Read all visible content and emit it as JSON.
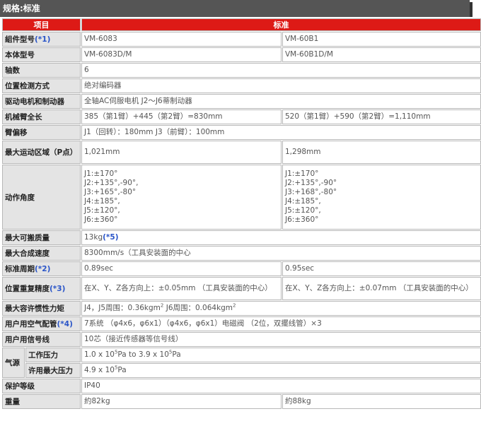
{
  "header": {
    "title": "规格:标准"
  },
  "table": {
    "col_item": "项目",
    "col_std": "标准",
    "rows": {
      "model": {
        "label": "組件型号",
        "ref": "(*1)",
        "a": "VM-6083",
        "b": "VM-60B1"
      },
      "body_model": {
        "label": "本体型号",
        "a": "VM-6083D/M",
        "b": "VM-60B1D/M"
      },
      "axes": {
        "label": "轴数",
        "v": "6"
      },
      "position": {
        "label": "位置检测方式",
        "v": "绝对编码器"
      },
      "drive": {
        "label": "驱动电机和制动器",
        "v": "全轴AC伺服电机 J2～J6蒂制动器"
      },
      "arm_length": {
        "label": "机械臂全长",
        "a": "385（第1臂）+445（第2臂）=830mm",
        "b": "520（第1臂）+590（第2臂）=1,110mm"
      },
      "offset": {
        "label": "臂偏移",
        "v": "J1（回转）：180mm J3（前臂）：100mm"
      },
      "reach": {
        "label": "最大运动区域（P点）",
        "a": "1,021mm",
        "b": "1,298mm"
      },
      "motion": {
        "label": "动作角度",
        "a": [
          "J1:±170°",
          "J2:+135°,-90°,",
          "J3:+165°,-80°",
          "J4:±185°,",
          "J5:±120°,",
          "J6:±360°"
        ],
        "b": [
          "J1:±170°",
          "J2:+135°,-90°",
          "J3:+168°,-80°",
          "J4:±185°,",
          "J5:±120°,",
          "J6:±360°"
        ]
      },
      "payload": {
        "label": "最大可搬质量",
        "v": "13kg",
        "ref": "(*5)"
      },
      "speed": {
        "label": "最大合成速度",
        "v": "8300mm/s（工具安装面的中心"
      },
      "cycle": {
        "label": "标准周期",
        "ref": "(*2)",
        "a": "0.89sec",
        "b": "0.95sec"
      },
      "repeat": {
        "label": "位置重复精度",
        "ref": "(*3)",
        "a": "在X、Y、Z各方向上：±0.05mm （工具安装面的中心）",
        "b": "在X、Y、Z各方向上：±0.07mm （工具安装面的中心）"
      },
      "inertia": {
        "label": "最大容许惯性力矩",
        "v1": "J4，J5周围：0.36kgm",
        "v1_sup": "2",
        "v2": " J6周围：0.064kgm",
        "v2_sup": "2"
      },
      "air": {
        "label": "用户用空气配管",
        "ref": "(*4)",
        "v": "7系统 （φ4x6，φ6x1）（φ4x6，φ6x1）电磁阀 （2位，双擺线管）×3"
      },
      "signal": {
        "label": "用户用信号线",
        "v": "10芯（接近传感器等信号线）"
      },
      "air_source": {
        "label": "气源",
        "work": {
          "label": "工作压力",
          "v1": "1.0 x 10",
          "v1_sup": "5",
          "v2": "Pa to 3.9 x 10",
          "v2_sup": "5",
          "v3": "Pa"
        },
        "max": {
          "label": "许用最大压力",
          "v1": "4.9 x 10",
          "v1_sup": "5",
          "v2": "Pa"
        }
      },
      "protection": {
        "label": "保护等级",
        "v": "IP40"
      },
      "weight": {
        "label": "重量",
        "a": "約82kg",
        "b": "約88kg"
      }
    }
  }
}
